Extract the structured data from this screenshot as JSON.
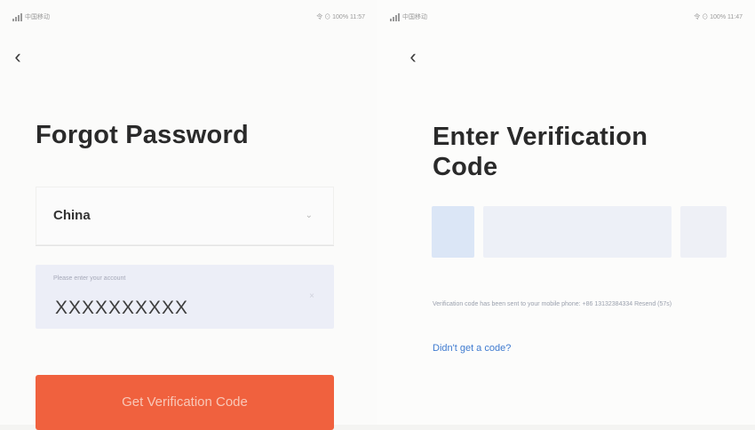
{
  "left_screen": {
    "status": {
      "carrier": "中国移动",
      "right": "令 ⊙ 100% 11:57"
    },
    "title": "Forgot Password",
    "country": {
      "label": "China",
      "arrow": "⌄"
    },
    "account": {
      "placeholder": "Please enter your account",
      "value": "XXXXXXXXXX",
      "clear": "×"
    },
    "button_label": "Get Verification Code"
  },
  "right_screen": {
    "status": {
      "carrier": "中国移动",
      "right": "令 ⊙ 100% 11:47"
    },
    "title": "Enter Verification Code",
    "message": "Verification code has been sent to your mobile phone: +86 13132384334 Resend (57s)",
    "resend": "Didn't get a code?"
  },
  "icons": {
    "back": "chevron-left-icon",
    "select": "chevron-down-icon",
    "clear": "close-icon",
    "signal": "signal-icon"
  },
  "colors": {
    "accent": "#f0613e",
    "link": "#3f7bd0",
    "field_bg": "#eceef7"
  }
}
